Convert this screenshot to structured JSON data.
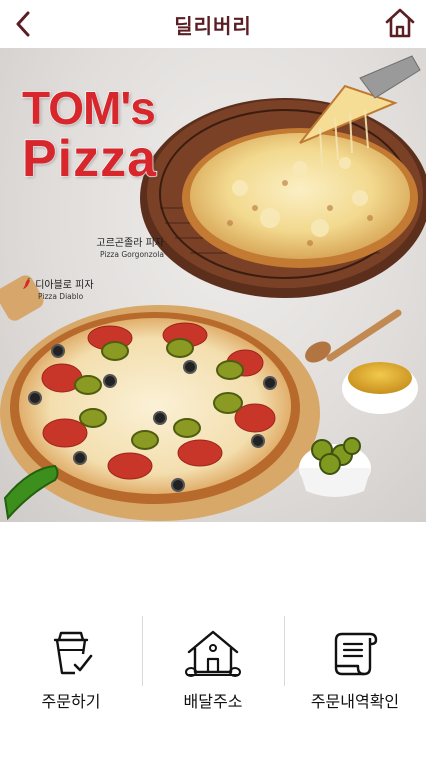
{
  "header": {
    "title": "딜리버리",
    "back_icon": "chevron-left-icon",
    "home_icon": "home-icon",
    "accent_color": "#5a1e23"
  },
  "hero": {
    "brand_line1": "TOM's",
    "brand_line2": "Pizza",
    "brand_color": "#d7262c",
    "pizza_gorgonzola": {
      "name_ko": "고르곤졸라 피자",
      "name_en": "Pizza Gorgonzola"
    },
    "pizza_diablo": {
      "name_ko": "디아블로 피자",
      "name_en": "Pizza Diablo",
      "icon": "chili-pepper-icon"
    }
  },
  "menu": {
    "items": [
      {
        "label": "주문하기",
        "icon": "cup-check-icon"
      },
      {
        "label": "배달주소",
        "icon": "house-icon"
      },
      {
        "label": "주문내역확인",
        "icon": "receipt-scroll-icon"
      }
    ]
  }
}
